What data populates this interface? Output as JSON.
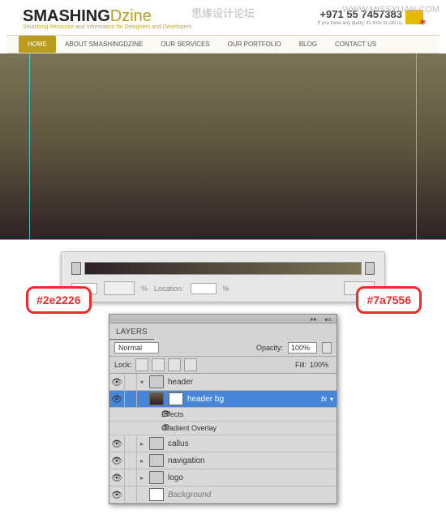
{
  "watermark": "思缘设计论坛",
  "watermark_url": "WWW.MISSYUAN.COM",
  "header": {
    "logo_a": "SMASHING",
    "logo_b": "Dzine",
    "tagline": "Smashing Resource and Information for Designers and Developers",
    "phone": "+971 55 7457383",
    "phone_sub": "If you have any query, its time to call us"
  },
  "nav": {
    "items": [
      {
        "label": "HOME",
        "active": true
      },
      {
        "label": "ABOUT SMASHINGDZINE"
      },
      {
        "label": "OUR SERVICES"
      },
      {
        "label": "OUR PORTFOLIO"
      },
      {
        "label": "BLOG"
      },
      {
        "label": "CONTACT US"
      }
    ]
  },
  "gradient_panel": {
    "hex_left": "#2e2226",
    "hex_right": "#7a7556",
    "percent": "%",
    "location_label": "Location:"
  },
  "layers_panel": {
    "tab": "LAYERS",
    "blend_mode": "Normal",
    "opacity_label": "Opacity:",
    "opacity_value": "100%",
    "lock_label": "Lock:",
    "fill_label": "Fill:",
    "fill_value": "100%",
    "fx_label": "fx",
    "effects_label": "Effects",
    "gradient_overlay_label": "Gradient Overlay",
    "layers": [
      {
        "name": "header",
        "type": "folder"
      },
      {
        "name": "header bg",
        "type": "layer",
        "selected": true,
        "fx": true
      },
      {
        "name": "callus",
        "type": "folder"
      },
      {
        "name": "navigation",
        "type": "folder"
      },
      {
        "name": "logo",
        "type": "folder"
      },
      {
        "name": "Background",
        "type": "bg",
        "italic": true
      }
    ]
  },
  "chart_data": {
    "type": "gradient",
    "stops": [
      {
        "position": 0,
        "color": "#2e2226"
      },
      {
        "position": 100,
        "color": "#7a7556"
      }
    ]
  }
}
